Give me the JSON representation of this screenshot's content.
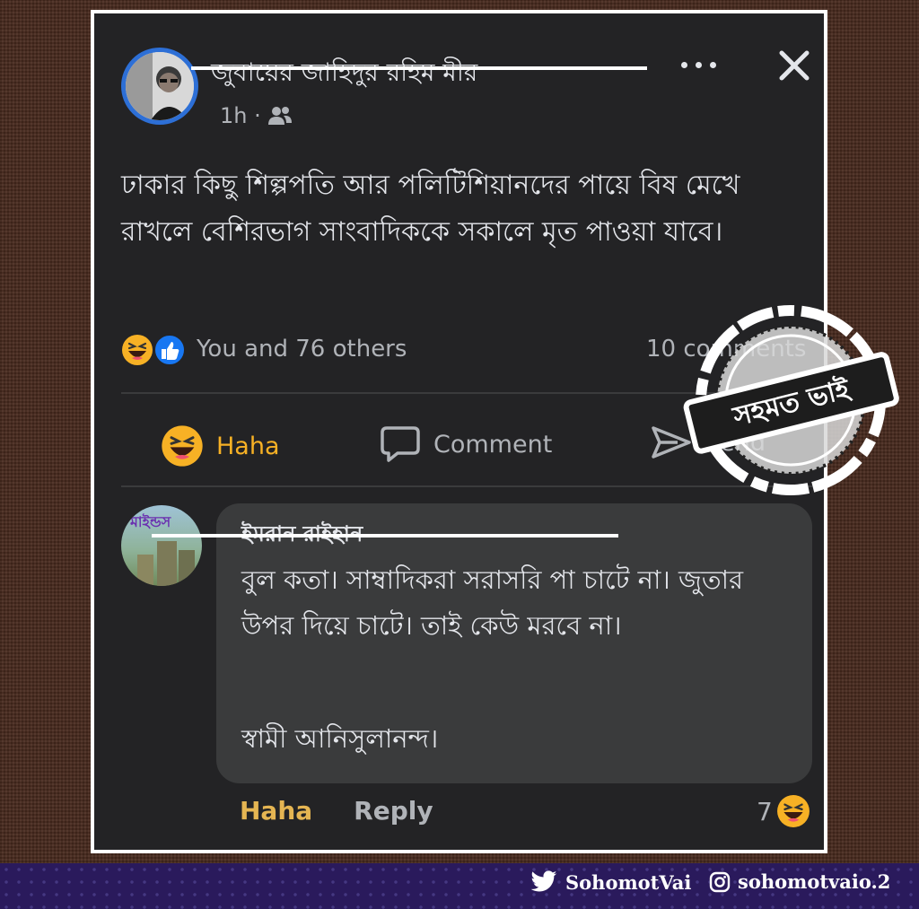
{
  "post": {
    "author": "জুবায়ের জাহিদুর রহিম মীর",
    "time": "1h ·",
    "text": "ঢাকার কিছু শিল্পপতি আর পলিটিশিয়ানদের পায়ে বিষ মেখে রাখলে বেশিরভাগ সাংবাদিককে সকালে মৃত পাওয়া যাবে।",
    "reactions_text": "You and 76 others",
    "comments_count": "10 comments",
    "actions": {
      "react_label": "Haha",
      "comment_label": "Comment",
      "send_label": "Send"
    }
  },
  "comment": {
    "avatar_text": "মাইন্ডস",
    "author": "ইমরান রাইহান",
    "body": "বুল কতা। সাম্বাদিকরা সরাসরি পা চাটে না। জুতার উপর দিয়ে চাটে। তাই কেউ মরবে না।",
    "signature": "স্বামী আনিসুলানন্দ।",
    "react_label": "Haha",
    "reply_label": "Reply",
    "reaction_count": "7"
  },
  "stamp_text": "সহমত ভাই",
  "footer": {
    "twitter_handle": "SohomotVai",
    "instagram_handle": "sohomotvaio.2"
  },
  "colors": {
    "haha_orange": "#f7b125",
    "like_blue": "#1877f2",
    "text_primary": "#e4e6eb",
    "text_secondary": "#b0b3b8",
    "card_bg": "#232325",
    "bubble_bg": "#3a3b3c",
    "reply_gray": "#b0b3b8",
    "haha_text": "#e5b552"
  }
}
